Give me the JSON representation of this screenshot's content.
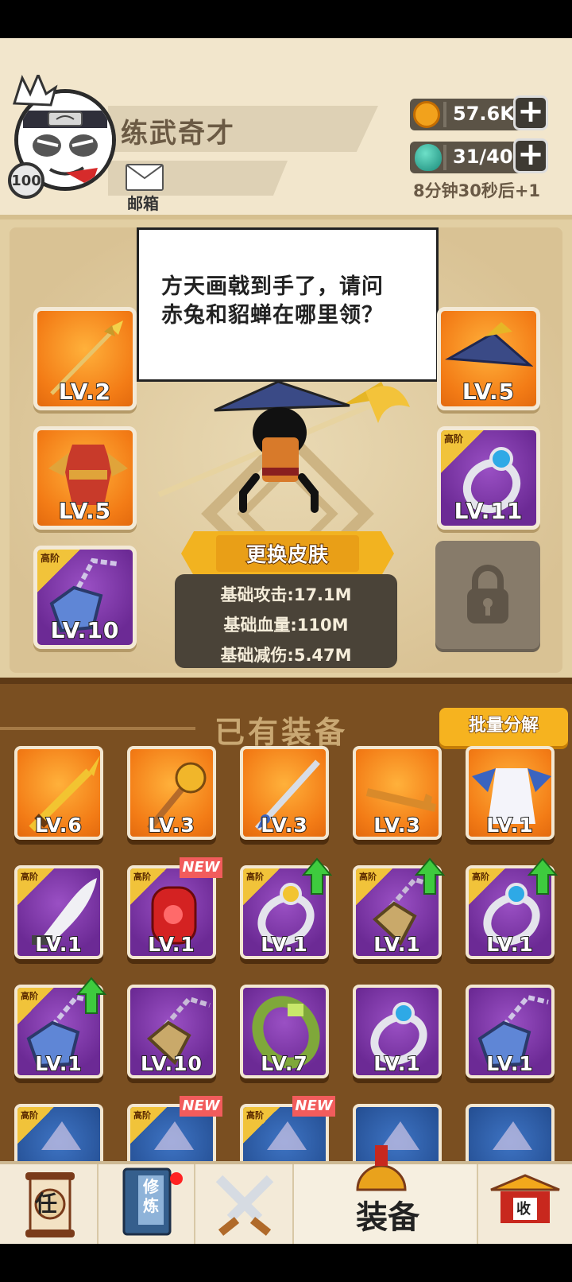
{
  "player": {
    "name": "练武奇才",
    "level": "100",
    "mail_label": "邮箱"
  },
  "resources": {
    "coins": "57.6K",
    "stamina": "31/40",
    "timer": "8分钟30秒后+1"
  },
  "speech": {
    "text_line1": "方天画戟到手了，请问",
    "text_line2": "赤兔和貂蝉在哪里领？"
  },
  "equipped": {
    "left": [
      {
        "name": "spear",
        "level": "LV.2",
        "rarity": "orange",
        "grade": ""
      },
      {
        "name": "armor",
        "level": "LV.5",
        "rarity": "orange",
        "grade": ""
      },
      {
        "name": "amulet",
        "level": "LV.10",
        "rarity": "purple",
        "grade": "高阶"
      }
    ],
    "right": [
      {
        "name": "hat",
        "level": "LV.5",
        "rarity": "orange",
        "grade": ""
      },
      {
        "name": "ring",
        "level": "LV.11",
        "rarity": "purple",
        "grade": "高阶"
      }
    ]
  },
  "skin_button": "更换皮肤",
  "stats": {
    "attack": "基础攻击:17.1M",
    "hp": "基础血量:110M",
    "reduction": "基础减伤:5.47M"
  },
  "inventory": {
    "title": "已有装备",
    "batch_label": "批量分解",
    "new_label": "NEW",
    "items": [
      {
        "name": "golden-sword",
        "level": "LV.6",
        "rarity": "orange",
        "grade": "",
        "new": false,
        "upgrade": false
      },
      {
        "name": "mace",
        "level": "LV.3",
        "rarity": "orange",
        "grade": "",
        "new": false,
        "upgrade": false
      },
      {
        "name": "blue-sword",
        "level": "LV.3",
        "rarity": "orange",
        "grade": "",
        "new": false,
        "upgrade": false
      },
      {
        "name": "key",
        "level": "LV.3",
        "rarity": "orange",
        "grade": "",
        "new": false,
        "upgrade": false
      },
      {
        "name": "robe",
        "level": "LV.1",
        "rarity": "orange",
        "grade": "",
        "new": false,
        "upgrade": false
      },
      {
        "name": "blade",
        "level": "LV.1",
        "rarity": "purple",
        "grade": "高阶",
        "new": false,
        "upgrade": false
      },
      {
        "name": "red-gauntlet",
        "level": "LV.1",
        "rarity": "purple",
        "grade": "高阶",
        "new": true,
        "upgrade": false
      },
      {
        "name": "gold-ring",
        "level": "LV.1",
        "rarity": "purple",
        "grade": "高阶",
        "new": false,
        "upgrade": true
      },
      {
        "name": "gold-necklace",
        "level": "LV.1",
        "rarity": "purple",
        "grade": "高阶",
        "new": false,
        "upgrade": true
      },
      {
        "name": "blue-ring",
        "level": "LV.1",
        "rarity": "purple",
        "grade": "高阶",
        "new": false,
        "upgrade": true
      },
      {
        "name": "blue-amulet",
        "level": "LV.1",
        "rarity": "purple",
        "grade": "高阶",
        "new": false,
        "upgrade": true
      },
      {
        "name": "gold-necklace",
        "level": "LV.10",
        "rarity": "purple",
        "grade": "",
        "new": false,
        "upgrade": false
      },
      {
        "name": "green-bracelet",
        "level": "LV.7",
        "rarity": "purple",
        "grade": "",
        "new": false,
        "upgrade": false
      },
      {
        "name": "blue-ring",
        "level": "LV.1",
        "rarity": "purple",
        "grade": "",
        "new": false,
        "upgrade": false
      },
      {
        "name": "blue-amulet",
        "level": "LV.1",
        "rarity": "purple",
        "grade": "",
        "new": false,
        "upgrade": false
      },
      {
        "name": "item-16",
        "level": "",
        "rarity": "blue",
        "grade": "高阶",
        "new": false,
        "upgrade": false
      },
      {
        "name": "item-17",
        "level": "",
        "rarity": "blue",
        "grade": "高阶",
        "new": true,
        "upgrade": false
      },
      {
        "name": "item-18",
        "level": "",
        "rarity": "blue",
        "grade": "高阶",
        "new": true,
        "upgrade": false
      },
      {
        "name": "item-19",
        "level": "",
        "rarity": "blue",
        "grade": "",
        "new": false,
        "upgrade": false
      },
      {
        "name": "item-20",
        "level": "",
        "rarity": "blue",
        "grade": "",
        "new": false,
        "upgrade": false
      }
    ]
  },
  "nav": {
    "tasks": "任",
    "cultivate": "修炼",
    "equip": "装备",
    "collect": "收"
  },
  "colors": {
    "header_bg": "#f2e6cc",
    "stage_bg": "#e2cfa3",
    "inventory_bg": "#7a4f21",
    "accent_gold": "#f6b31f",
    "rarity_orange": "#f37c16",
    "rarity_purple": "#6c2a95",
    "rarity_blue": "#244e92"
  }
}
